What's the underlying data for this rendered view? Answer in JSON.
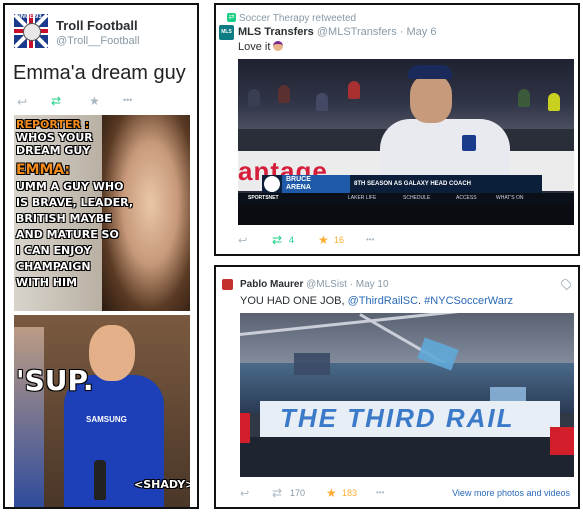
{
  "tweet1": {
    "author_name": "Troll Football",
    "author_handle": "@Troll__Football",
    "avatar_tag": "SINCE 93",
    "text": "Emma'a dream guy",
    "reply_icon": "↩",
    "retweet_icon": "⇄",
    "favorite_icon": "★",
    "more_icon": "•••",
    "meme": {
      "reporter_label": "REPORTER :",
      "reporter_line1": "WHOS YOUR",
      "reporter_line2": "DREAM GUY",
      "emma_label": "EMMA:",
      "answer_lines": [
        "UMM A GUY WHO",
        "IS BRAVE, LEADER,",
        "BRITISH MAYBE",
        "AND MATURE SO",
        "I CAN ENJOY",
        "CHAMPAIGN",
        "WITH HIM"
      ],
      "sup": "'SUP.",
      "shady": "<SHADY>",
      "sponsor": "SAMSUNG"
    }
  },
  "tweet2": {
    "retweeted_by": "Soccer Therapy retweeted",
    "avatar_text": "MLS",
    "author_name": "MLS Transfers",
    "author_handle": "@MLSTransfers",
    "date": "May 6",
    "text": "Love it",
    "video": {
      "board_text": "antage",
      "chyron_name_1": "BRUCE",
      "chyron_name_2": "ARENA",
      "chyron_title": "8TH SEASON AS GALAXY HEAD COACH",
      "network": "SPORTSNET",
      "menu": [
        "LAKER LIFE",
        "SCHEDULE",
        "ACCESS",
        "WHAT'S ON"
      ]
    },
    "retweet_count": "4",
    "favorite_count": "16"
  },
  "tweet3": {
    "author_name": "Pablo Maurer",
    "author_handle": "@MLSist",
    "date": "May 10",
    "text_prefix": "YOU HAD ONE JOB, ",
    "mention": "@ThirdRailSC",
    "hashtag": "#NYCSoccerWarz",
    "photo_banner": "THE THIRD RAIL",
    "retweet_count": "170",
    "favorite_count": "183",
    "view_more": "View more photos and videos"
  },
  "colors": {
    "retweet_green": "#19cf86",
    "favorite_gold": "#ffac33",
    "link_blue": "#2a6ab8",
    "muted_gray": "#8899a6"
  }
}
